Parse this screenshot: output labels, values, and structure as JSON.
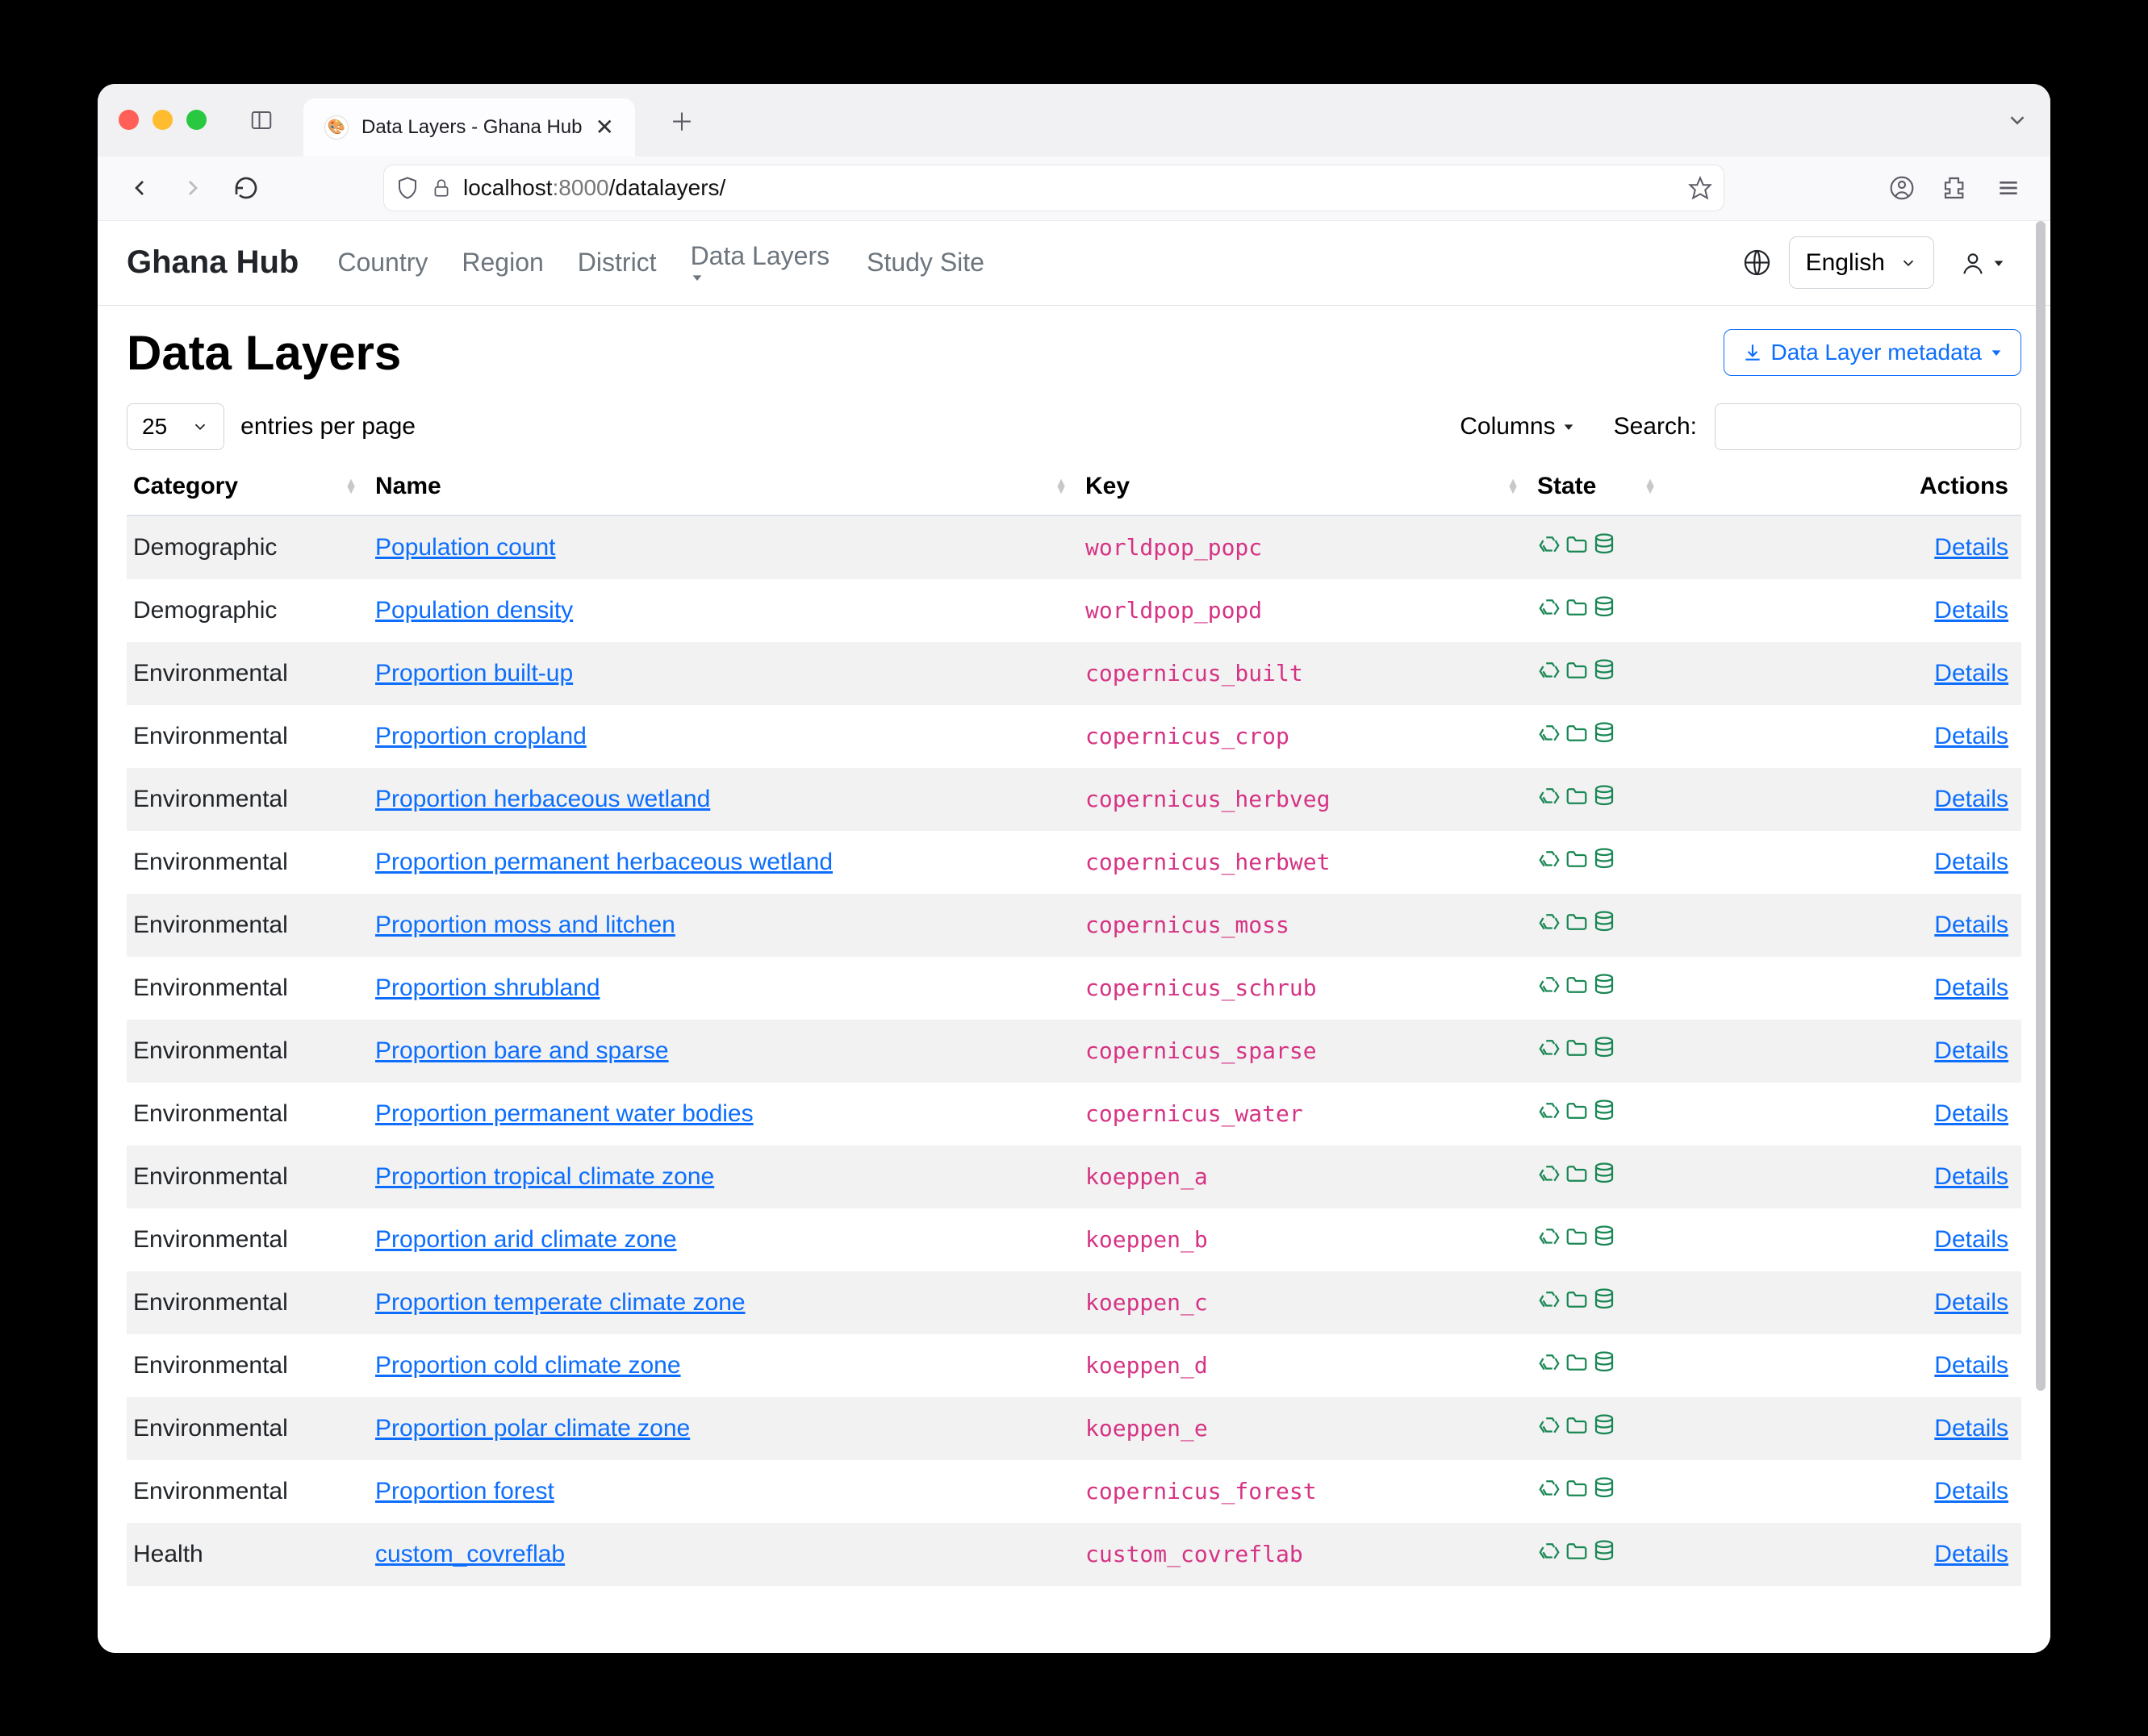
{
  "browser": {
    "tab_title": "Data Layers - Ghana Hub",
    "url_host": "localhost",
    "url_port": ":8000",
    "url_path": "/datalayers/"
  },
  "nav": {
    "brand": "Ghana Hub",
    "items": [
      "Country",
      "Region",
      "District",
      "Data Layers",
      "Study Site"
    ],
    "dropdown_index": 3,
    "language": "English"
  },
  "page": {
    "title": "Data Layers",
    "metadata_btn": "Data Layer metadata",
    "entries_select": "25",
    "entries_label": "entries per page",
    "columns_label": "Columns",
    "search_label": "Search:",
    "search_value": ""
  },
  "table": {
    "headers": {
      "category": "Category",
      "name": "Name",
      "key": "Key",
      "state": "State",
      "actions": "Actions"
    },
    "action_link": "Details",
    "rows": [
      {
        "category": "Demographic",
        "name": "Population count",
        "key": "worldpop_popc"
      },
      {
        "category": "Demographic",
        "name": "Population density",
        "key": "worldpop_popd"
      },
      {
        "category": "Environmental",
        "name": "Proportion built-up",
        "key": "copernicus_built"
      },
      {
        "category": "Environmental",
        "name": "Proportion cropland",
        "key": "copernicus_crop"
      },
      {
        "category": "Environmental",
        "name": "Proportion herbaceous wetland",
        "key": "copernicus_herbveg"
      },
      {
        "category": "Environmental",
        "name": "Proportion permanent herbaceous wetland",
        "key": "copernicus_herbwet"
      },
      {
        "category": "Environmental",
        "name": "Proportion moss and litchen",
        "key": "copernicus_moss"
      },
      {
        "category": "Environmental",
        "name": "Proportion shrubland",
        "key": "copernicus_schrub"
      },
      {
        "category": "Environmental",
        "name": "Proportion bare and sparse",
        "key": "copernicus_sparse"
      },
      {
        "category": "Environmental",
        "name": "Proportion permanent water bodies",
        "key": "copernicus_water"
      },
      {
        "category": "Environmental",
        "name": "Proportion tropical climate zone",
        "key": "koeppen_a"
      },
      {
        "category": "Environmental",
        "name": "Proportion arid climate zone",
        "key": "koeppen_b"
      },
      {
        "category": "Environmental",
        "name": "Proportion temperate climate zone",
        "key": "koeppen_c"
      },
      {
        "category": "Environmental",
        "name": "Proportion cold climate zone",
        "key": "koeppen_d"
      },
      {
        "category": "Environmental",
        "name": "Proportion polar climate zone",
        "key": "koeppen_e"
      },
      {
        "category": "Environmental",
        "name": "Proportion forest",
        "key": "copernicus_forest"
      },
      {
        "category": "Health",
        "name": "custom_covreflab",
        "key": "custom_covreflab"
      }
    ]
  }
}
